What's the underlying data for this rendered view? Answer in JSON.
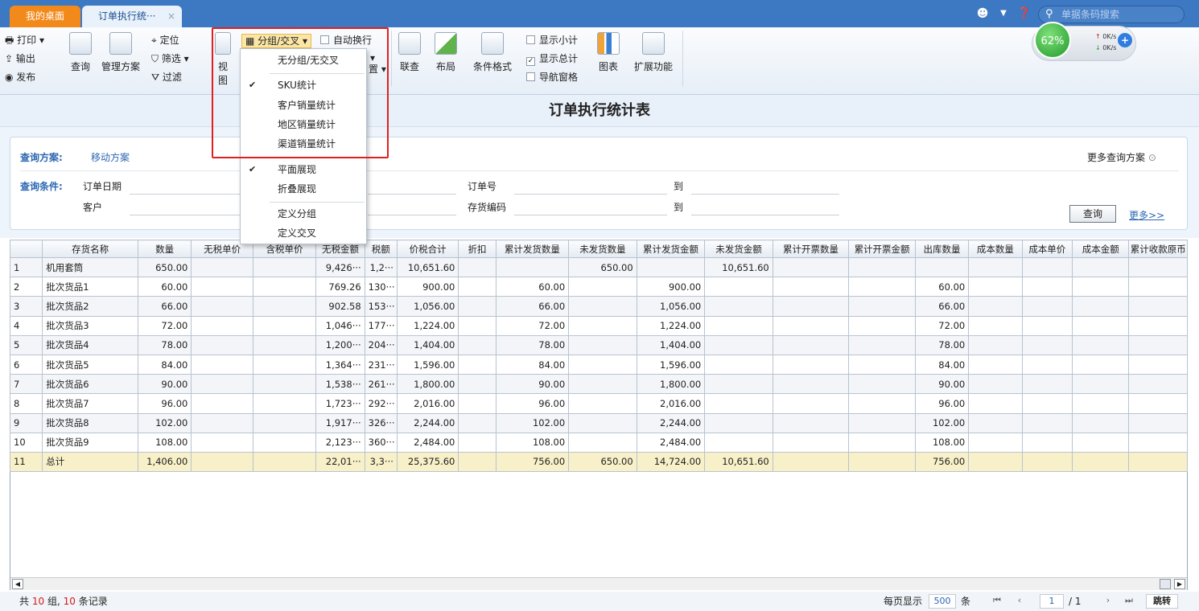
{
  "tabs": {
    "desk": "我的桌面",
    "order": "订单执行统···",
    "close": "×"
  },
  "search": {
    "placeholder": "单据条码搜索"
  },
  "toolbar": {
    "print": "打印",
    "export": "输出",
    "publish": "发布",
    "query": "查询",
    "manage_plan": "管理方案",
    "locate": "定位",
    "filter": "筛选",
    "filter2": "过滤",
    "view": "视图",
    "group_cross": "分组/交叉",
    "auto_wrap": "自动换行",
    "link": "联查",
    "layout": "布局",
    "cond_format": "条件格式",
    "show_subtotal": "显示小计",
    "show_total": "显示总计",
    "nav_pane": "导航窗格",
    "chart": "图表",
    "extend": "扩展功能"
  },
  "gauge": {
    "percent": "62%",
    "up": "0K/s",
    "down": "0K/s"
  },
  "menu": {
    "items": [
      "无分组/无交叉",
      "SKU统计",
      "客户销量统计",
      "地区销量统计",
      "渠道销量统计",
      "平面展现",
      "折叠展现",
      "定义分组",
      "定义交叉"
    ],
    "hidden_fragment": "置"
  },
  "page_title": "订单执行统计表",
  "query": {
    "plan_label": "查询方案:",
    "plan_value": "移动方案",
    "more_plans": "更多查询方案",
    "cond_label": "查询条件:",
    "order_date": "订单日期",
    "customer": "客户",
    "order_no": "订单号",
    "inv_code": "存货编码",
    "to": "到",
    "btn": "查询",
    "more": "更多>>"
  },
  "table": {
    "headers": [
      "",
      "存货名称",
      "数量",
      "无税单价",
      "含税单价",
      "无税金额",
      "税额",
      "价税合计",
      "折扣",
      "累计发货数量",
      "未发货数量",
      "累计发货金额",
      "未发货金额",
      "累计开票数量",
      "累计开票金额",
      "出库数量",
      "成本数量",
      "成本单价",
      "成本金额",
      "累计收款原币"
    ],
    "rows": [
      [
        "1",
        "机用套筒",
        "650.00",
        "",
        "",
        "9,426···",
        "1,2···",
        "10,651.60",
        "",
        "",
        "650.00",
        "",
        "10,651.60",
        "",
        "",
        "",
        "",
        "",
        "",
        ""
      ],
      [
        "2",
        "批次货品1",
        "60.00",
        "",
        "",
        "769.26",
        "130···",
        "900.00",
        "",
        "60.00",
        "",
        "900.00",
        "",
        "",
        "",
        "60.00",
        "",
        "",
        "",
        ""
      ],
      [
        "3",
        "批次货品2",
        "66.00",
        "",
        "",
        "902.58",
        "153···",
        "1,056.00",
        "",
        "66.00",
        "",
        "1,056.00",
        "",
        "",
        "",
        "66.00",
        "",
        "",
        "",
        ""
      ],
      [
        "4",
        "批次货品3",
        "72.00",
        "",
        "",
        "1,046···",
        "177···",
        "1,224.00",
        "",
        "72.00",
        "",
        "1,224.00",
        "",
        "",
        "",
        "72.00",
        "",
        "",
        "",
        ""
      ],
      [
        "5",
        "批次货品4",
        "78.00",
        "",
        "",
        "1,200···",
        "204···",
        "1,404.00",
        "",
        "78.00",
        "",
        "1,404.00",
        "",
        "",
        "",
        "78.00",
        "",
        "",
        "",
        ""
      ],
      [
        "6",
        "批次货品5",
        "84.00",
        "",
        "",
        "1,364···",
        "231···",
        "1,596.00",
        "",
        "84.00",
        "",
        "1,596.00",
        "",
        "",
        "",
        "84.00",
        "",
        "",
        "",
        ""
      ],
      [
        "7",
        "批次货品6",
        "90.00",
        "",
        "",
        "1,538···",
        "261···",
        "1,800.00",
        "",
        "90.00",
        "",
        "1,800.00",
        "",
        "",
        "",
        "90.00",
        "",
        "",
        "",
        ""
      ],
      [
        "8",
        "批次货品7",
        "96.00",
        "",
        "",
        "1,723···",
        "292···",
        "2,016.00",
        "",
        "96.00",
        "",
        "2,016.00",
        "",
        "",
        "",
        "96.00",
        "",
        "",
        "",
        ""
      ],
      [
        "9",
        "批次货品8",
        "102.00",
        "",
        "",
        "1,917···",
        "326···",
        "2,244.00",
        "",
        "102.00",
        "",
        "2,244.00",
        "",
        "",
        "",
        "102.00",
        "",
        "",
        "",
        ""
      ],
      [
        "10",
        "批次货品9",
        "108.00",
        "",
        "",
        "2,123···",
        "360···",
        "2,484.00",
        "",
        "108.00",
        "",
        "2,484.00",
        "",
        "",
        "",
        "108.00",
        "",
        "",
        "",
        ""
      ],
      [
        "11",
        "总计",
        "1,406.00",
        "",
        "",
        "22,01···",
        "3,3···",
        "25,375.60",
        "",
        "756.00",
        "650.00",
        "14,724.00",
        "10,651.60",
        "",
        "",
        "756.00",
        "",
        "",
        "",
        ""
      ]
    ]
  },
  "status": {
    "prefix": "共",
    "groups": "10",
    "mid": "组,",
    "records": "10",
    "suffix": "条记录",
    "per_page_label": "每页显示",
    "per_page": "500",
    "unit": "条",
    "page": "1",
    "total_pages": "/ 1",
    "jump": "跳转"
  }
}
